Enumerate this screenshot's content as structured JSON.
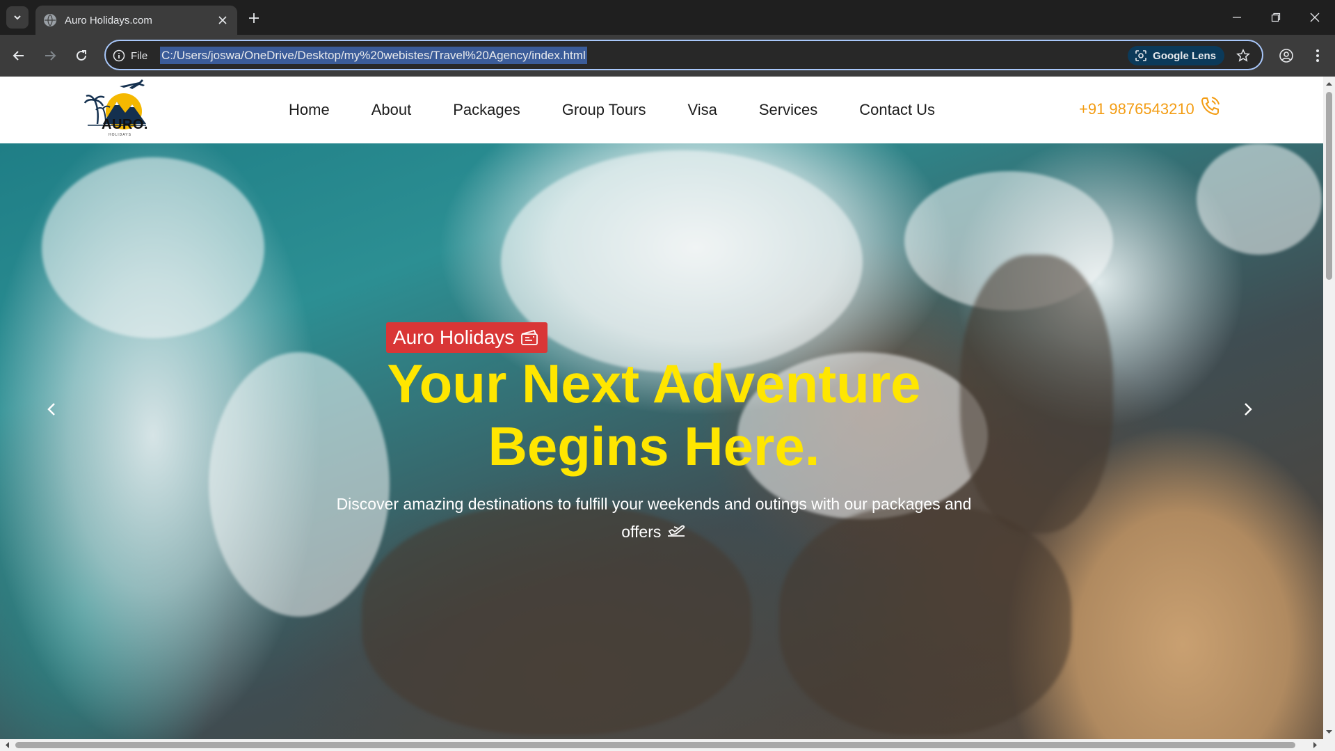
{
  "browser": {
    "tab_title": "Auro Holidays.com",
    "site_info_label": "File",
    "url": "C:/Users/joswa/OneDrive/Desktop/my%20webistes/Travel%20Agency/index.html",
    "lens_label": "Google Lens"
  },
  "header": {
    "logo_text": "AURO.",
    "logo_sub": "HOLIDAYS",
    "nav": [
      "Home",
      "About",
      "Packages",
      "Group Tours",
      "Visa",
      "Services",
      "Contact Us"
    ],
    "phone": "+91 9876543210"
  },
  "hero": {
    "badge": "Auro Holidays",
    "title_line1": "Your Next Adventure",
    "title_line2": "Begins Here.",
    "text_line1": "Discover amazing destinations to fulfill your weekends and outings with our packages and",
    "text_line2": "offers"
  },
  "colors": {
    "accent_yellow": "#ffe600",
    "badge_red": "#d93636",
    "phone_orange": "#f39c12"
  }
}
